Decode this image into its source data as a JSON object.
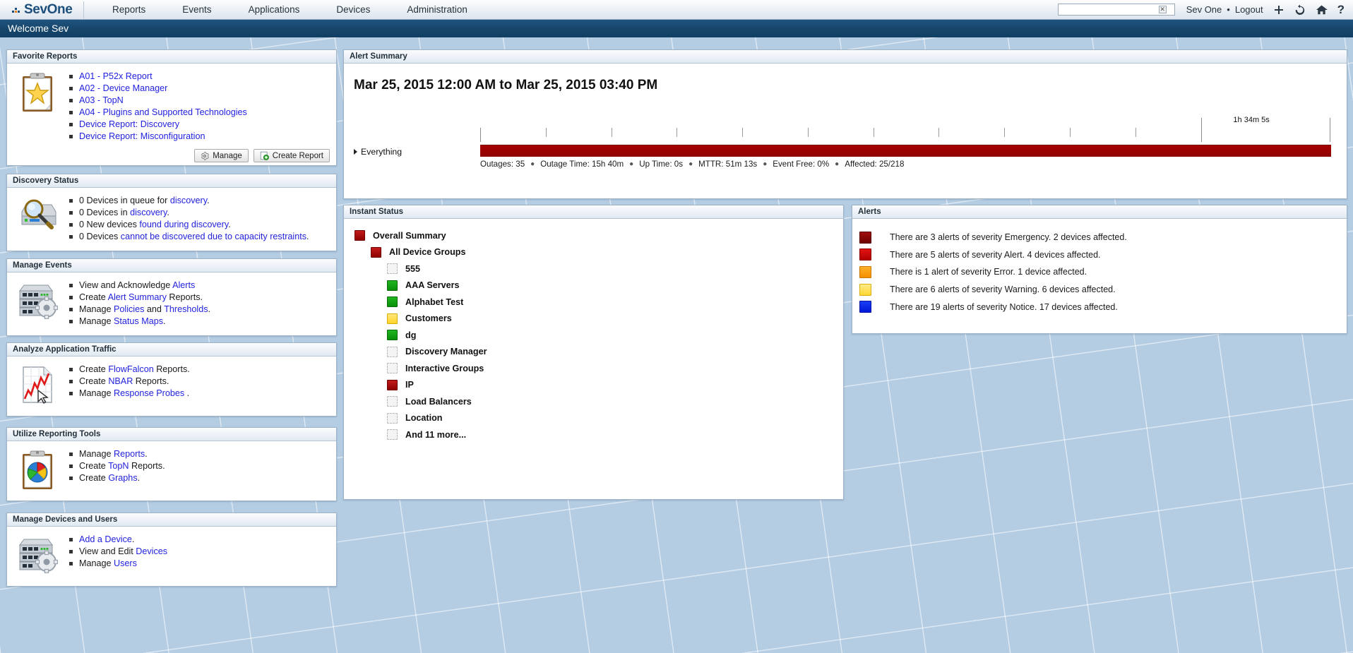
{
  "topnav": {
    "logo": "SevOne",
    "items": [
      {
        "label": "Reports"
      },
      {
        "label": "Events"
      },
      {
        "label": "Applications"
      },
      {
        "label": "Devices"
      },
      {
        "label": "Administration"
      }
    ],
    "search": {
      "value": "",
      "placeholder": ""
    },
    "user": "Sev One",
    "separator": "•",
    "logout": "Logout",
    "icons": [
      "add-icon",
      "refresh-icon",
      "home-icon",
      "help-icon"
    ],
    "icon_glyphs": {
      "add": "+",
      "refresh": "↻",
      "home": "⌂",
      "help": "?"
    }
  },
  "welcome": {
    "text": "Welcome Sev"
  },
  "favorite_reports": {
    "title": "Favorite Reports",
    "links": [
      "A01 - P52x Report",
      "A02 - Device Manager",
      "A03 - TopN",
      "A04 - Plugins and Supported Technologies",
      "Device Report: Discovery",
      "Device Report: Misconfiguration"
    ],
    "manage_label": "Manage",
    "create_label": "Create Report"
  },
  "discovery_status": {
    "title": "Discovery Status",
    "items": [
      {
        "pre": "0 Devices in queue for ",
        "link": "discovery",
        "post": "."
      },
      {
        "pre": "0 Devices in ",
        "link": "discovery",
        "post": "."
      },
      {
        "pre": "0 New devices ",
        "link": "found during discovery",
        "post": "."
      },
      {
        "pre": "0 Devices ",
        "link": "cannot be discovered due to capacity restraints",
        "post": "."
      }
    ]
  },
  "manage_events": {
    "title": "Manage Events",
    "items": [
      {
        "pre": "View and Acknowledge ",
        "link": "Alerts",
        "post": ""
      },
      {
        "pre": "Create ",
        "link": "Alert Summary",
        "post": " Reports."
      },
      {
        "pre": "Manage ",
        "link": "Policies",
        "mid": " and ",
        "link2": "Thresholds",
        "post": "."
      },
      {
        "pre": "Manage ",
        "link": "Status Maps",
        "post": "."
      }
    ]
  },
  "analyze_traffic": {
    "title": "Analyze Application Traffic",
    "items": [
      {
        "pre": "Create ",
        "link": "FlowFalcon",
        "post": " Reports."
      },
      {
        "pre": "Create ",
        "link": "NBAR",
        "post": " Reports."
      },
      {
        "pre": "Manage ",
        "link": "Response Probes",
        "post": " ."
      }
    ]
  },
  "reporting_tools": {
    "title": "Utilize Reporting Tools",
    "items": [
      {
        "pre": "Manage ",
        "link": "Reports",
        "post": "."
      },
      {
        "pre": "Create ",
        "link": "TopN",
        "post": " Reports."
      },
      {
        "pre": "Create ",
        "link": "Graphs",
        "post": "."
      }
    ]
  },
  "devices_users": {
    "title": "Manage Devices and Users",
    "items": [
      {
        "pre": "",
        "link": "Add a Device",
        "post": "."
      },
      {
        "pre": "View and Edit ",
        "link": "Devices",
        "post": ""
      },
      {
        "pre": "Manage ",
        "link": "Users",
        "post": ""
      }
    ]
  },
  "alert_summary": {
    "title": "Alert Summary",
    "range": "Mar 25, 2015 12:00 AM to Mar 25, 2015 03:40 PM",
    "row_label": "Everything",
    "interval_label": "1h 34m 5s",
    "stats": [
      "Outages: 35",
      "Outage Time: 15h 40m",
      "Up Time: 0s",
      "MTTR: 51m 13s",
      "Event Free: 0%",
      "Affected: 25/218"
    ],
    "bar_color": "#9c0202"
  },
  "instant_status": {
    "title": "Instant Status",
    "nodes": [
      {
        "label": "Overall Summary",
        "status": "red",
        "indent": 0
      },
      {
        "label": "All Device Groups",
        "status": "red",
        "indent": 1
      },
      {
        "label": "555",
        "status": "empty",
        "indent": 2
      },
      {
        "label": "AAA Servers",
        "status": "green",
        "indent": 2
      },
      {
        "label": "Alphabet Test",
        "status": "green",
        "indent": 2
      },
      {
        "label": "Customers",
        "status": "yellow",
        "indent": 2
      },
      {
        "label": "dg",
        "status": "green",
        "indent": 2
      },
      {
        "label": "Discovery Manager",
        "status": "empty",
        "indent": 2
      },
      {
        "label": "Interactive Groups",
        "status": "empty",
        "indent": 2
      },
      {
        "label": "IP",
        "status": "red",
        "indent": 2
      },
      {
        "label": "Load Balancers",
        "status": "empty",
        "indent": 2
      },
      {
        "label": "Location",
        "status": "empty",
        "indent": 2
      },
      {
        "label": "And 11 more...",
        "status": "empty",
        "indent": 2
      }
    ]
  },
  "alerts": {
    "title": "Alerts",
    "rows": [
      {
        "severity": "emergency",
        "text": "There are 3 alerts of severity Emergency. 2 devices affected.",
        "color": "#6d0000"
      },
      {
        "severity": "alert",
        "text": "There are 5 alerts of severity Alert. 4 devices affected.",
        "color": "#cc0000"
      },
      {
        "severity": "error",
        "text": "There is 1 alert of severity Error. 1 device affected.",
        "color": "#f59000"
      },
      {
        "severity": "warning",
        "text": "There are 6 alerts of severity Warning. 6 devices affected.",
        "color": "#ffd633"
      },
      {
        "severity": "notice",
        "text": "There are 19 alerts of severity Notice. 17 devices affected.",
        "color": "#0018d8"
      }
    ]
  }
}
